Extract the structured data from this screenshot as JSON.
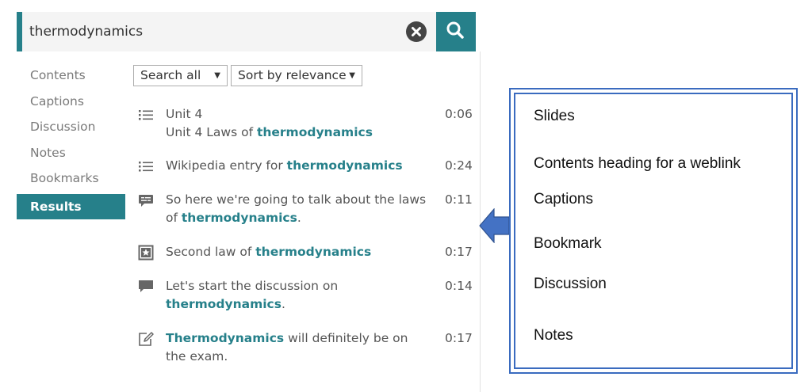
{
  "search": {
    "value": "thermodynamics",
    "accent_color": "#26808a"
  },
  "sidebar": {
    "items": [
      {
        "label": "Contents"
      },
      {
        "label": "Captions"
      },
      {
        "label": "Discussion"
      },
      {
        "label": "Notes"
      },
      {
        "label": "Bookmarks"
      },
      {
        "label": "Results",
        "active": true
      }
    ]
  },
  "filters": {
    "scope": "Search all",
    "sort": "Sort by relevance"
  },
  "results": [
    {
      "icon": "list-icon",
      "line1": "Unit 4",
      "line2_pre": "Unit 4 Laws of ",
      "line2_hl": "thermodynamics",
      "time": "0:06"
    },
    {
      "icon": "list-icon",
      "pre": "Wikipedia entry for ",
      "hl": "thermodynamics",
      "time": "0:24"
    },
    {
      "icon": "caption-icon",
      "pre": "So here we're going to talk about the laws of ",
      "hl": "thermodynamics",
      "post": ".",
      "time": "0:11"
    },
    {
      "icon": "bookmark-icon",
      "pre": "Second law of ",
      "hl": "thermodynamics",
      "time": "0:17"
    },
    {
      "icon": "discussion-icon",
      "pre": "Let's start the discussion on ",
      "hl": "thermodynamics",
      "post": ".",
      "time": "0:14"
    },
    {
      "icon": "note-icon",
      "hl": "Thermodynamics",
      "post": " will definitely be on the exam.",
      "time": "0:17"
    }
  ],
  "legend": {
    "items": [
      "Slides",
      "Contents heading for a weblink",
      "Captions",
      "Bookmark",
      "Discussion",
      "Notes"
    ],
    "border_color": "#3a6bbf",
    "arrow_color": "#4472c4"
  }
}
